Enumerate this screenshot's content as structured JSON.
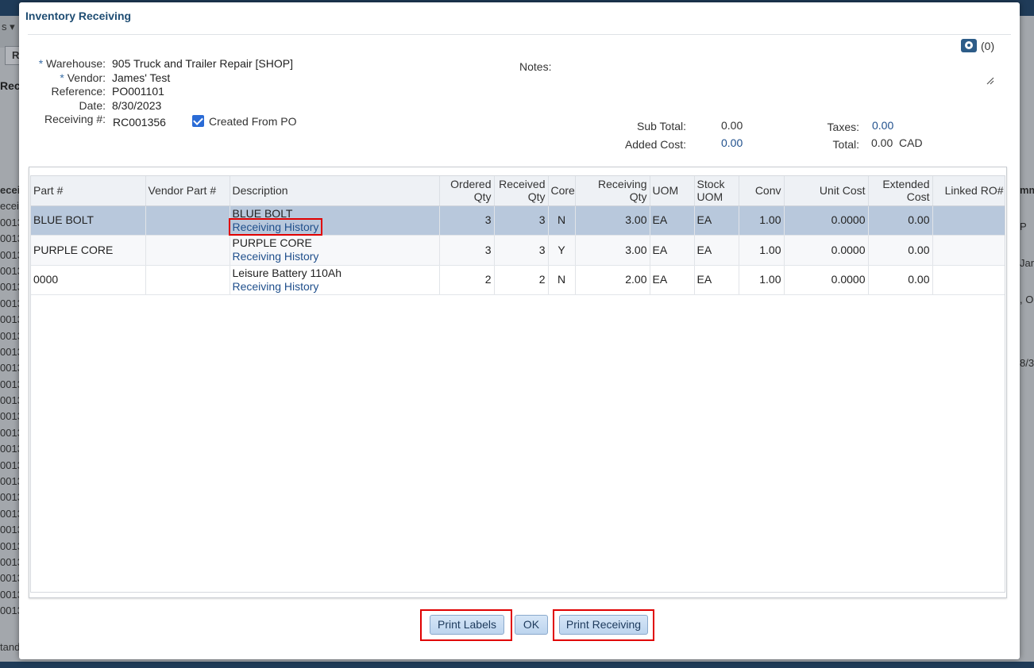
{
  "background": {
    "strip_text": "s ▾",
    "tab_label": "R",
    "heading": "Rec",
    "list_header": "eceiv",
    "list_items": [
      "eceivi",
      "0013",
      "0013",
      "0013",
      "0013",
      "0013",
      "0013",
      "0013",
      "0013",
      "0013",
      "0013",
      "0013",
      "0013",
      "0013",
      "0013",
      "0013",
      "0013",
      "0013",
      "0013",
      "0013",
      "0013",
      "0013",
      "0013",
      "0013",
      "0013",
      "0013"
    ],
    "right_items": [
      "mm",
      "P",
      "Jan",
      ", O",
      "8/3"
    ],
    "bottom_text": "tand"
  },
  "modal": {
    "title": "Inventory Receiving",
    "attachments_count": "(0)"
  },
  "form": {
    "required_marker": "*",
    "warehouse_label": "Warehouse:",
    "warehouse_value": "905 Truck and Trailer Repair [SHOP]",
    "vendor_label": "Vendor:",
    "vendor_value": "James' Test",
    "reference_label": "Reference:",
    "reference_value": "PO001101",
    "date_label": "Date:",
    "date_value": "8/30/2023",
    "receiving_label": "Receiving #:",
    "receiving_value": "RC001356",
    "created_from_po_label": "Created From PO",
    "created_from_po_checked": true,
    "notes_label": "Notes:"
  },
  "summary": {
    "subtotal_label": "Sub Total:",
    "subtotal_value": "0.00",
    "added_cost_label": "Added Cost:",
    "added_cost_value": "0.00",
    "taxes_label": "Taxes:",
    "taxes_value": "0.00",
    "total_label": "Total:",
    "total_value": "0.00",
    "currency": "CAD"
  },
  "table": {
    "headers": {
      "part": "Part #",
      "vendor_part": "Vendor Part #",
      "description": "Description",
      "ordered_qty_1": "Ordered",
      "ordered_qty_2": "Qty",
      "received_qty_1": "Received",
      "received_qty_2": "Qty",
      "core": "Core",
      "receiving_qty": "Receiving Qty",
      "uom": "UOM",
      "stock_uom_1": "Stock",
      "stock_uom_2": "UOM",
      "conv": "Conv",
      "unit_cost": "Unit Cost",
      "extended_cost_1": "Extended",
      "extended_cost_2": "Cost",
      "linked_ro": "Linked RO#"
    },
    "rows": [
      {
        "part": "BLUE BOLT",
        "vendor_part": "",
        "description": "BLUE BOLT",
        "history_link": "Receiving History",
        "ordered": "3",
        "received": "3",
        "core": "N",
        "receiving_qty": "3.00",
        "uom": "EA",
        "stock_uom": "EA",
        "conv": "1.00",
        "unit_cost": "0.0000",
        "extended_cost": "0.00",
        "linked_ro": ""
      },
      {
        "part": "PURPLE CORE",
        "vendor_part": "",
        "description": "PURPLE CORE",
        "history_link": "Receiving History",
        "ordered": "3",
        "received": "3",
        "core": "Y",
        "receiving_qty": "3.00",
        "uom": "EA",
        "stock_uom": "EA",
        "conv": "1.00",
        "unit_cost": "0.0000",
        "extended_cost": "0.00",
        "linked_ro": ""
      },
      {
        "part": "0000",
        "vendor_part": "",
        "description": "Leisure Battery 110Ah",
        "history_link": "Receiving History",
        "ordered": "2",
        "received": "2",
        "core": "N",
        "receiving_qty": "2.00",
        "uom": "EA",
        "stock_uom": "EA",
        "conv": "1.00",
        "unit_cost": "0.0000",
        "extended_cost": "0.00",
        "linked_ro": ""
      }
    ]
  },
  "buttons": {
    "print_labels": "Print Labels",
    "ok": "OK",
    "print_receiving": "Print Receiving"
  },
  "colors": {
    "title": "#1f4d73",
    "link": "#1f4f8c",
    "selected_row": "#b8c8dc",
    "highlight_box": "#e00000"
  }
}
